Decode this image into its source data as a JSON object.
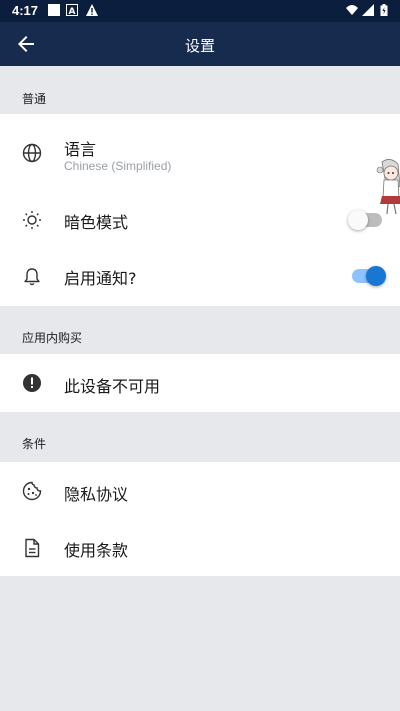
{
  "status_bar": {
    "time": "4:17",
    "icons": [
      "notification-square-icon",
      "a-icon",
      "warning-icon",
      "wifi-icon",
      "signal-icon",
      "battery-icon"
    ]
  },
  "app_bar": {
    "title": "设置",
    "back_icon": "arrow-back-icon"
  },
  "sections": {
    "general": {
      "header": "普通",
      "language": {
        "label": "语言",
        "value": "Chinese (Simplified)"
      },
      "dark_mode": {
        "label": "暗色模式",
        "enabled": false
      },
      "notifications": {
        "label": "启用通知?",
        "enabled": true
      }
    },
    "iap": {
      "header": "应用内购买",
      "unavailable": {
        "label": "此设备不可用"
      }
    },
    "terms": {
      "header": "条件",
      "privacy": {
        "label": "隐私协议"
      },
      "terms_of_use": {
        "label": "使用条款"
      }
    }
  },
  "colors": {
    "status_bar": "#0b1e3e",
    "app_bar": "#162b4d",
    "background": "#e6e8ec",
    "toggle_on": "#1976d2"
  }
}
